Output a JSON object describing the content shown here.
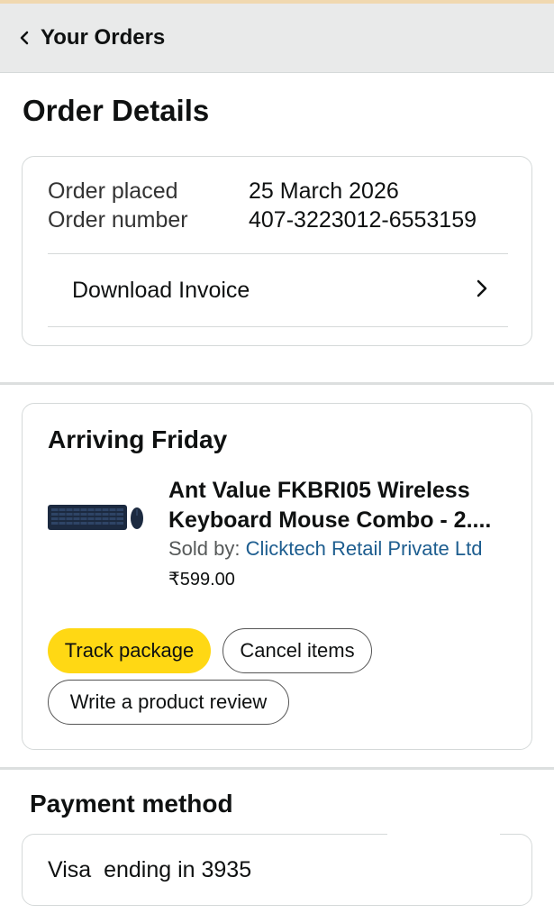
{
  "header": {
    "back_icon": "chevron-left-icon",
    "title": "Your Orders"
  },
  "page": {
    "title": "Order Details"
  },
  "order_info": {
    "placed_label": "Order placed",
    "placed_value": "25 March 2026",
    "number_label": "Order number",
    "number_value": "407-3223012-6553159",
    "invoice_label": "Download Invoice",
    "invoice_icon": "chevron-right-icon"
  },
  "shipment": {
    "status": "Arriving Friday",
    "product": {
      "image_icon": "keyboard-mouse-image",
      "title": "Ant Value FKBRI05 Wireless Keyboard Mouse Combo - 2....",
      "sold_by_label": "Sold by: ",
      "seller": "Clicktech Retail Private Ltd",
      "price": "₹599.00"
    },
    "buttons": {
      "track": "Track package",
      "cancel": "Cancel items",
      "review": "Write a product review"
    }
  },
  "payment": {
    "title": "Payment method",
    "card_text": "Visa  ending in 3935"
  },
  "colors": {
    "header_bg": "#e9eaea",
    "track_button": "#ffd814",
    "seller_link": "#1d5d8f",
    "border": "#d5d9d9"
  }
}
